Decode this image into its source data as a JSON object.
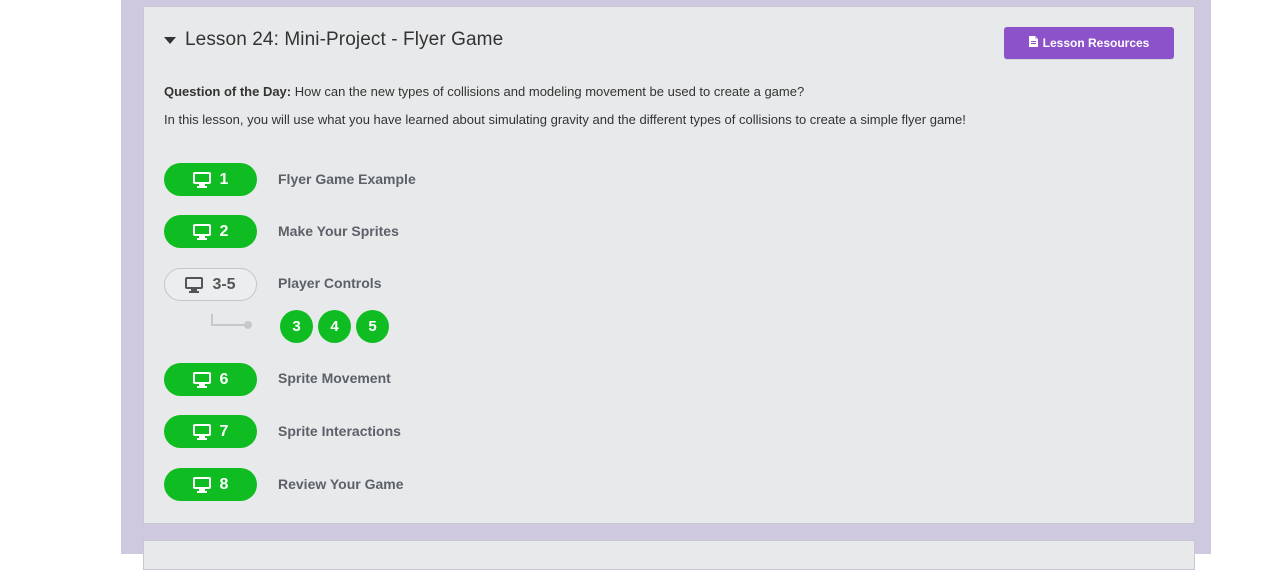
{
  "lesson": {
    "title": "Lesson 24: Mini-Project - Flyer Game",
    "resources_label": "Lesson Resources",
    "question_label": "Question of the Day:",
    "question_text": " How can the new types of collisions and modeling movement be used to create a game?",
    "intro": "In this lesson, you will use what you have learned about simulating gravity and the different types of collisions to create a simple flyer game!"
  },
  "levels": [
    {
      "number": "1",
      "label": "Flyer Game Example",
      "status": "complete"
    },
    {
      "number": "2",
      "label": "Make Your Sprites",
      "status": "complete"
    },
    {
      "number": "3-5",
      "label": "Player Controls",
      "status": "group",
      "sublevels": [
        "3",
        "4",
        "5"
      ]
    },
    {
      "number": "6",
      "label": "Sprite Movement",
      "status": "complete"
    },
    {
      "number": "7",
      "label": "Sprite Interactions",
      "status": "complete"
    },
    {
      "number": "8",
      "label": "Review Your Game",
      "status": "complete"
    }
  ],
  "colors": {
    "complete": "#0fbd22",
    "resources_button": "#8c52c9",
    "outer_background": "#cfc9e0"
  },
  "icons": {
    "caret": "caret-down-icon",
    "resources": "document-icon",
    "level": "computer-monitor-icon"
  }
}
